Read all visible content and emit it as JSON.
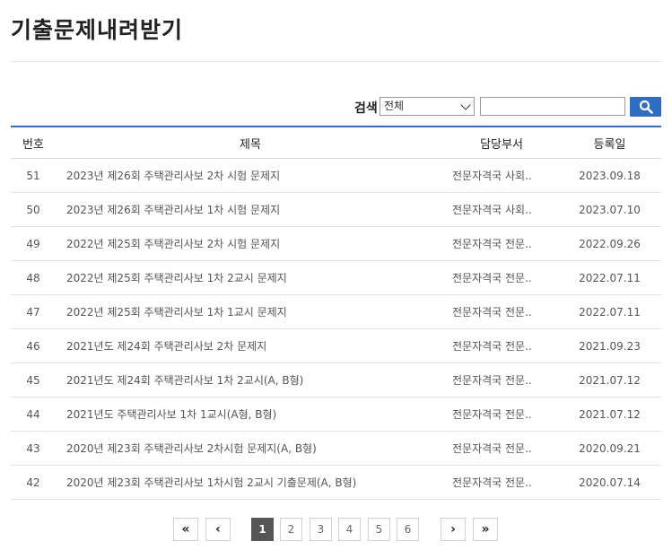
{
  "page": {
    "title": "기출문제내려받기"
  },
  "search": {
    "label": "검색",
    "scope_selected": "전체",
    "query_value": "",
    "button_icon": "search-icon"
  },
  "table": {
    "headers": {
      "num": "번호",
      "title": "제목",
      "dept": "담당부서",
      "date": "등록일"
    },
    "rows": [
      {
        "num": "51",
        "title": "2023년 제26회 주택관리사보 2차 시험 문제지",
        "dept": "전문자격국 사회..",
        "date": "2023.09.18"
      },
      {
        "num": "50",
        "title": "2023년 제26회 주택관리사보 1차 시험 문제지",
        "dept": "전문자격국 사회..",
        "date": "2023.07.10"
      },
      {
        "num": "49",
        "title": "2022년 제25회 주택관리사보 2차 시험 문제지",
        "dept": "전문자격국 전문..",
        "date": "2022.09.26"
      },
      {
        "num": "48",
        "title": "2022년 제25회 주택관리사보 1차 2교시 문제지",
        "dept": "전문자격국 전문..",
        "date": "2022.07.11"
      },
      {
        "num": "47",
        "title": "2022년 제25회 주택관리사보 1차 1교시 문제지",
        "dept": "전문자격국 전문..",
        "date": "2022.07.11"
      },
      {
        "num": "46",
        "title": "2021년도 제24회 주택관리사보 2차 문제지",
        "dept": "전문자격국 전문..",
        "date": "2021.09.23"
      },
      {
        "num": "45",
        "title": "2021년도 제24회 주택관리사보 1차 2교시(A, B형)",
        "dept": "전문자격국 전문..",
        "date": "2021.07.12"
      },
      {
        "num": "44",
        "title": "2021년도 주택관리사보 1차 1교시(A형, B형)",
        "dept": "전문자격국 전문..",
        "date": "2021.07.12"
      },
      {
        "num": "43",
        "title": "2020년 제23회 주택관리사보 2차시험 문제지(A, B형)",
        "dept": "전문자격국 전문..",
        "date": "2020.09.21"
      },
      {
        "num": "42",
        "title": "2020년 제23회 주택관리사보 1차시험 2교시 기출문제(A, B형)",
        "dept": "전문자격국 전문..",
        "date": "2020.07.14"
      }
    ]
  },
  "pagination": {
    "first": "«",
    "prev": "‹",
    "pages": [
      "1",
      "2",
      "3",
      "4",
      "5",
      "6"
    ],
    "current": "1",
    "next": "›",
    "last": "»"
  },
  "colors": {
    "accent": "#2f6ec2",
    "active_page": "#555555"
  }
}
